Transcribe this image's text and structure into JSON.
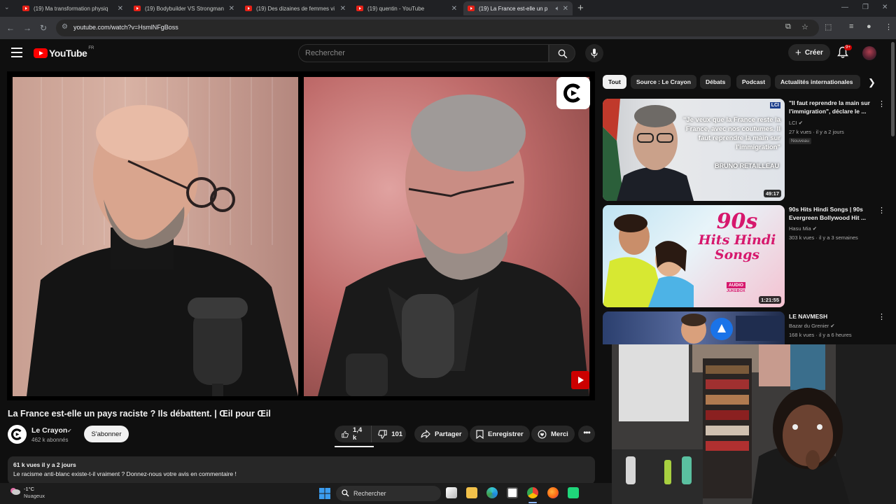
{
  "browser": {
    "tabs": [
      {
        "title": "(19) Ma transformation physiq",
        "active": false
      },
      {
        "title": "(19) Bodybuilder VS Strongman",
        "active": false
      },
      {
        "title": "(19) Des dizaines de femmes vi",
        "active": false
      },
      {
        "title": "(19) quentin - YouTube",
        "active": false
      },
      {
        "title": "(19) La France est-elle un p",
        "active": true
      }
    ],
    "url": "youtube.com/watch?v=HsmlNFgBoss"
  },
  "header": {
    "logo_text": "YouTube",
    "country_code": "FR",
    "search_placeholder": "Rechercher",
    "create_label": "Créer",
    "notification_badge": "9+"
  },
  "video": {
    "title": "La France est-elle un pays raciste ? Ils débattent. | Œil pour Œil",
    "channel_name": "Le Crayon",
    "subscribers": "462 k abonnés",
    "subscribe_label": "S'abonner",
    "likes": "1,4 k",
    "dislikes": "101",
    "share_label": "Partager",
    "save_label": "Enregistrer",
    "thanks_label": "Merci",
    "description_meta": "61 k vues  il y a 2 jours",
    "description_text": "Le racisme anti-blanc existe-t-il vraiment ? Donnez-nous votre avis en commentaire !"
  },
  "chips": [
    "Tout",
    "Source : Le Crayon",
    "Débats",
    "Podcast",
    "Actualités internationales"
  ],
  "recommendations": [
    {
      "title": "\"Il faut reprendre la main sur l'immigration\", déclare le ...",
      "channel": "LCI",
      "stats": "27 k vues · il y a 2 jours",
      "badge": "Nouveau",
      "duration": "49:17",
      "thumb_quote": "\"Je veux que la France reste la France, avec nos coutumes. Il faut reprendre la main sur l'immigration\"",
      "thumb_name": "BRUNO RETAILLEAU",
      "thumb_logo": "LCI"
    },
    {
      "title": "90s Hits Hindi Songs | 90s Evergreen Bollywood Hit ...",
      "channel": "Hasu Mia",
      "stats": "303 k vues · il y a 3 semaines",
      "duration": "1:21:55",
      "thumb_big": "90s",
      "thumb_line1": "Hits Hindi",
      "thumb_line2": "Songs",
      "thumb_tag1": "AUDIO",
      "thumb_tag2": "JUKEBOX"
    },
    {
      "title": "LE NAVMESH",
      "channel": "Bazar du Grenier",
      "stats": "168 k vues · il y a 6 heures"
    }
  ],
  "taskbar": {
    "temperature": "-1°C",
    "condition": "Nuageux",
    "search_label": "Rechercher"
  },
  "colors": {
    "youtube_red": "#ff0000",
    "background": "#0f0f0f",
    "chip_bg": "#272727"
  }
}
